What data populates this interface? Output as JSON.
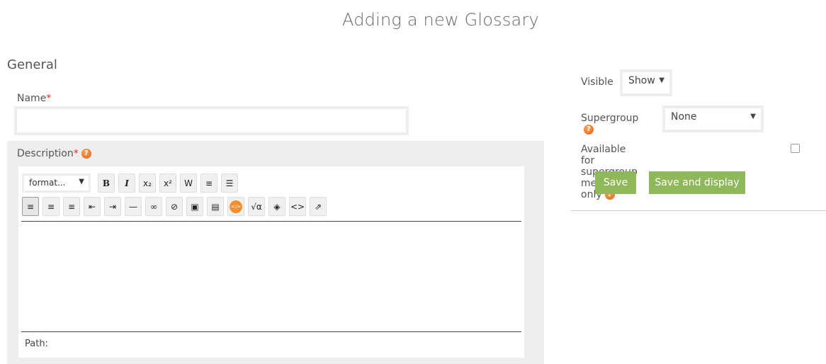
{
  "page": {
    "title": "Adding a new Glossary"
  },
  "general": {
    "heading": "General",
    "name": {
      "label": "Name",
      "required": "*",
      "value": "",
      "placeholder": ""
    },
    "description": {
      "label": "Description",
      "required": "*",
      "help": "?",
      "format_select": "format...",
      "toolbar_row1": [
        {
          "name": "bold",
          "glyph": "B"
        },
        {
          "name": "italic",
          "glyph": "I"
        },
        {
          "name": "subscript",
          "glyph": "x₂"
        },
        {
          "name": "superscript",
          "glyph": "x²"
        },
        {
          "name": "paste-from-word",
          "glyph": "W"
        },
        {
          "name": "ordered-list",
          "glyph": "≡"
        },
        {
          "name": "unordered-list",
          "glyph": "☰"
        }
      ],
      "toolbar_row2": [
        {
          "name": "align-left",
          "glyph": "≡"
        },
        {
          "name": "align-center",
          "glyph": "≡"
        },
        {
          "name": "align-right",
          "glyph": "≡"
        },
        {
          "name": "outdent",
          "glyph": "⇤"
        },
        {
          "name": "indent",
          "glyph": "⇥"
        },
        {
          "name": "horizontal-rule",
          "glyph": "—"
        },
        {
          "name": "link",
          "glyph": "∞"
        },
        {
          "name": "unlink",
          "glyph": "⊘"
        },
        {
          "name": "image",
          "glyph": "▣"
        },
        {
          "name": "media",
          "glyph": "▤"
        },
        {
          "name": "html-embed",
          "glyph": "</>"
        },
        {
          "name": "equation",
          "glyph": "√α"
        },
        {
          "name": "special-char",
          "glyph": "◈"
        },
        {
          "name": "source-code",
          "glyph": "<>"
        },
        {
          "name": "fullscreen",
          "glyph": "⇗"
        }
      ],
      "path_label": "Path:"
    }
  },
  "side": {
    "visible": {
      "label": "Visible",
      "value": "Show"
    },
    "supergroup": {
      "label": "Supergroup",
      "help": "?",
      "value": "None"
    },
    "members_only": {
      "label": "Available for supergroup members only",
      "help": "?",
      "checked": false
    },
    "save": "Save",
    "save_display": "Save and display"
  },
  "colors": {
    "accent": "#8fb85a",
    "help": "#e2621b",
    "required": "#e03030"
  }
}
